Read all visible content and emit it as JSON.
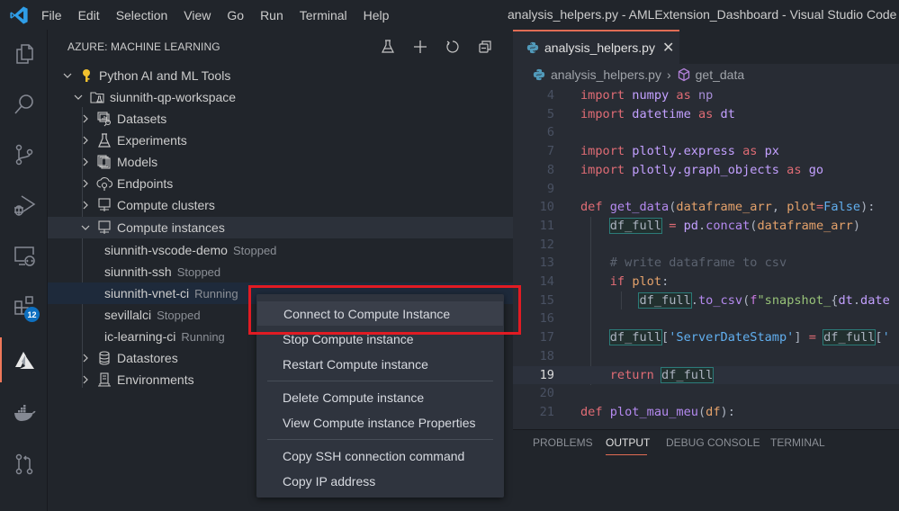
{
  "titlebar": {
    "menu": [
      "File",
      "Edit",
      "Selection",
      "View",
      "Go",
      "Run",
      "Terminal",
      "Help"
    ],
    "window_title": "analysis_helpers.py - AMLExtension_Dashboard - Visual Studio Code"
  },
  "activitybar": {
    "items": [
      {
        "icon": "explorer-icon"
      },
      {
        "icon": "search-icon"
      },
      {
        "icon": "source-control-icon"
      },
      {
        "icon": "run-debug-icon"
      },
      {
        "icon": "remote-explorer-icon"
      },
      {
        "icon": "extensions-icon",
        "badge": "12"
      },
      {
        "icon": "azure-icon",
        "active": true
      },
      {
        "icon": "docker-icon"
      },
      {
        "icon": "pull-requests-icon"
      }
    ]
  },
  "sidebar": {
    "title": "AZURE: MACHINE LEARNING",
    "actions": [
      "flask-icon",
      "plus-icon",
      "refresh-icon",
      "collapse-all-icon"
    ],
    "tree": {
      "subscription": "Python AI and ML Tools",
      "workspace": "siunnith-qp-workspace",
      "nodes": [
        {
          "label": "Datasets",
          "icon": "datasets-icon"
        },
        {
          "label": "Experiments",
          "icon": "flask-icon"
        },
        {
          "label": "Models",
          "icon": "models-icon"
        },
        {
          "label": "Endpoints",
          "icon": "endpoints-icon"
        },
        {
          "label": "Compute clusters",
          "icon": "compute-icon"
        },
        {
          "label": "Compute instances",
          "icon": "compute-icon"
        },
        {
          "label": "Datastores",
          "icon": "database-icon"
        },
        {
          "label": "Environments",
          "icon": "environment-icon"
        }
      ],
      "instances": [
        {
          "name": "siunnith-vscode-demo",
          "status": "Stopped"
        },
        {
          "name": "siunnith-ssh",
          "status": "Stopped"
        },
        {
          "name": "siunnith-vnet-ci",
          "status": "Running"
        },
        {
          "name": "sevillalci",
          "status": "Stopped"
        },
        {
          "name": "ic-learning-ci",
          "status": "Running"
        }
      ]
    }
  },
  "editor": {
    "tab_label": "analysis_helpers.py",
    "breadcrumb": {
      "file": "analysis_helpers.py",
      "symbol": "get_data"
    },
    "line_numbers": [
      "4",
      "5",
      "6",
      "7",
      "8",
      "9",
      "10",
      "11",
      "12",
      "13",
      "14",
      "15",
      "16",
      "17",
      "18",
      "19",
      "20",
      "21"
    ],
    "current_line": "19"
  },
  "panel": {
    "tabs": [
      "PROBLEMS",
      "OUTPUT",
      "DEBUG CONSOLE",
      "TERMINAL"
    ],
    "active_tab": "OUTPUT"
  },
  "context_menu": {
    "groups": [
      [
        "Connect to Compute Instance",
        "Stop Compute instance",
        "Restart Compute instance"
      ],
      [
        "Delete Compute instance",
        "View Compute instance Properties"
      ],
      [
        "Copy SSH connection command",
        "Copy IP address"
      ]
    ]
  },
  "colors": {
    "accent": "#e06c54",
    "highlight_box": "#e11b23",
    "badge": "#0e70c0"
  }
}
